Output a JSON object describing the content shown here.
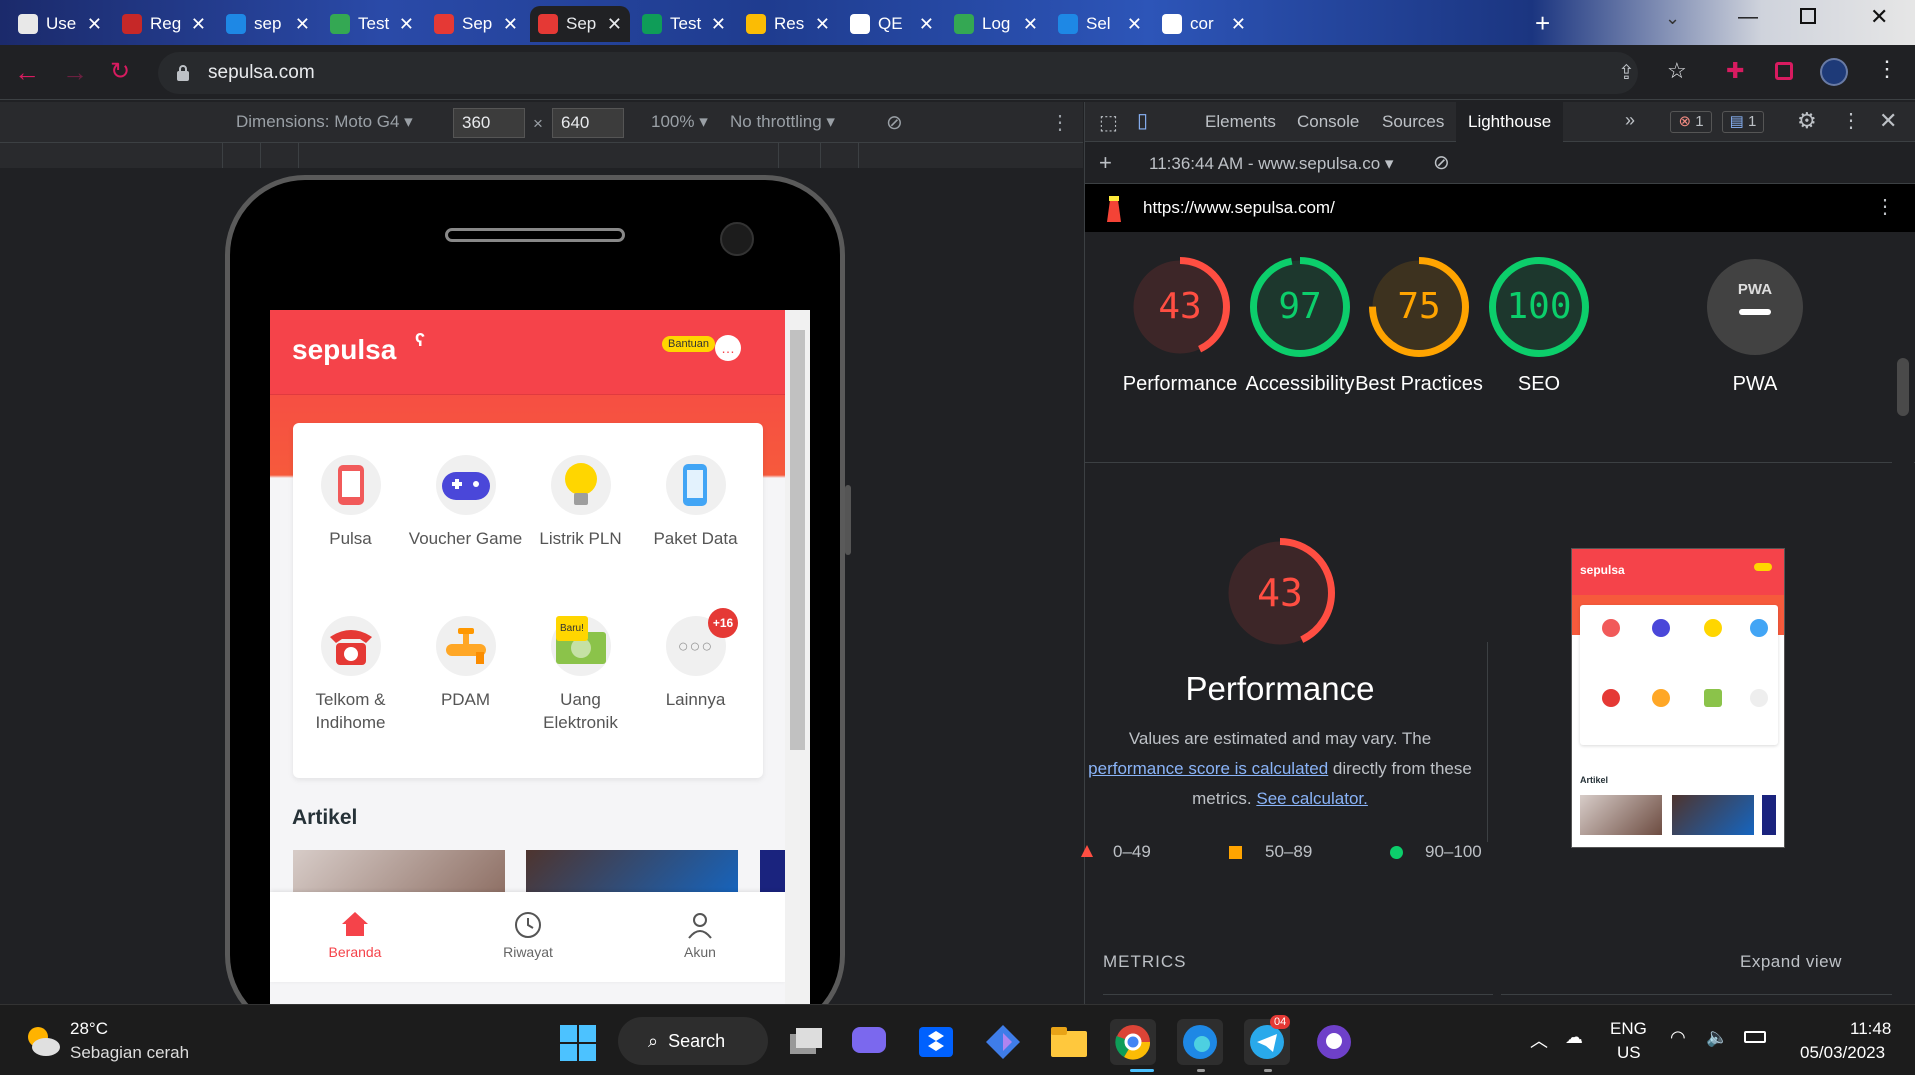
{
  "browser": {
    "tabs": [
      {
        "title": "Use",
        "color": "#e8e8e8"
      },
      {
        "title": "Reg",
        "color": "#c62828"
      },
      {
        "title": "sep",
        "color": "#1e88e5"
      },
      {
        "title": "Test",
        "color": "#34a853"
      },
      {
        "title": "Sep",
        "color": "#e53935"
      },
      {
        "title": "Sep",
        "color": "#e53935"
      },
      {
        "title": "Test",
        "color": "#0f9d58"
      },
      {
        "title": "Res",
        "color": "#fbbc04"
      },
      {
        "title": "QE",
        "color": "#ffffff"
      },
      {
        "title": "Log",
        "color": "#34a853"
      },
      {
        "title": "Sel",
        "color": "#1e88e5"
      },
      {
        "title": "cor",
        "color": "#ffffff"
      }
    ],
    "url": "sepulsa.com"
  },
  "device_toolbar": {
    "dimensions_label": "Dimensions: Moto G4",
    "width": "360",
    "height": "640",
    "times": "×",
    "zoom": "100%",
    "throttling": "No throttling"
  },
  "app": {
    "logo": "sepulsa",
    "help_badge": "Bantuan",
    "services": [
      {
        "label": "Pulsa",
        "icon": "phone-icon"
      },
      {
        "label": "Voucher Game",
        "icon": "gamepad-icon"
      },
      {
        "label": "Listrik PLN",
        "icon": "lightbulb-icon"
      },
      {
        "label": "Paket Data",
        "icon": "mobile-data-icon"
      },
      {
        "label": "Telkom & Indihome",
        "icon": "telephone-icon"
      },
      {
        "label": "PDAM",
        "icon": "water-tap-icon"
      },
      {
        "label": "Uang Elektronik",
        "icon": "e-money-icon"
      },
      {
        "label": "Lainnya",
        "icon": "more-icon"
      }
    ],
    "new_badge": "Baru!",
    "more_badge": "+16",
    "article_heading": "Artikel",
    "nav": [
      {
        "label": "Beranda",
        "icon": "home-icon"
      },
      {
        "label": "Riwayat",
        "icon": "clock-icon"
      },
      {
        "label": "Akun",
        "icon": "user-icon"
      }
    ]
  },
  "devtools": {
    "tabs": [
      "Elements",
      "Console",
      "Sources",
      "Lighthouse"
    ],
    "errors": "1",
    "messages": "1",
    "report_time": "11:36:44 AM - www.sepulsa.co",
    "report_url": "https://www.sepulsa.com/",
    "scores": [
      {
        "value": 43,
        "label": "Performance",
        "color": "#ff4e42"
      },
      {
        "value": 97,
        "label": "Accessibility",
        "color": "#0cce6b"
      },
      {
        "value": 75,
        "label": "Best Practices",
        "color": "#ffa400"
      },
      {
        "value": 100,
        "label": "SEO",
        "color": "#0cce6b"
      }
    ],
    "pwa_label": "PWA",
    "pwa_badge": "PWA",
    "main_score": 43,
    "main_title": "Performance",
    "desc_1": "Values are estimated and may vary. The",
    "desc_link_1": "performance score is calculated",
    "desc_2": "directly from these",
    "desc_3": "metrics.",
    "desc_link_2": "See calculator.",
    "legend": [
      {
        "range": "0–49",
        "color": "#ff4e42"
      },
      {
        "range": "50–89",
        "color": "#ffa400"
      },
      {
        "range": "90–100",
        "color": "#0cce6b"
      }
    ],
    "metrics_label": "METRICS",
    "expand_label": "Expand view"
  },
  "taskbar": {
    "temperature": "28°C",
    "weather": "Sebagian cerah",
    "search": "Search",
    "lang_1": "ENG",
    "lang_2": "US",
    "time": "11:48",
    "date": "05/03/2023",
    "telegram_badge": "04"
  }
}
